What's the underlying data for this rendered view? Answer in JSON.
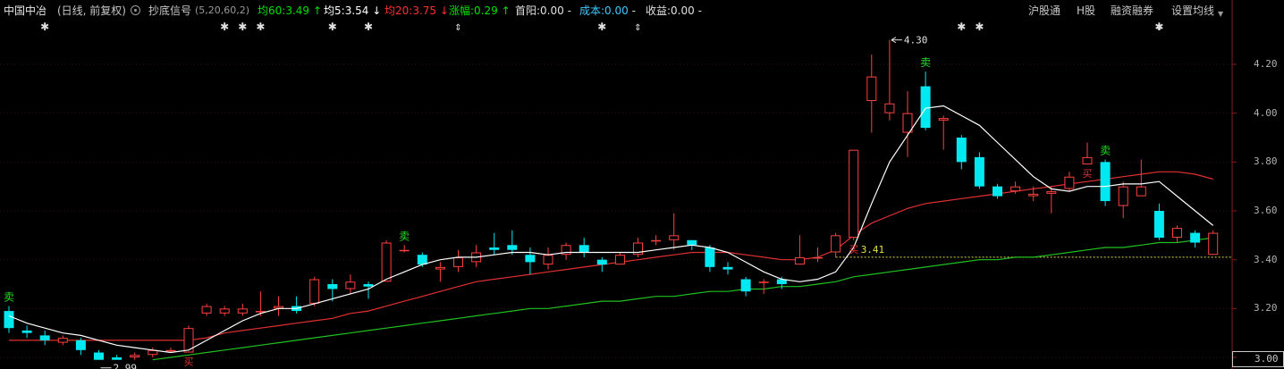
{
  "header": {
    "stock_name": "中国中冶",
    "mode": "(日线, 前复权)",
    "indicator_name": "抄底信号",
    "indicator_params": "(5,20,60,2)",
    "ma60": {
      "label": "均60:",
      "value": "3.49",
      "arrow": "↑",
      "color": "#00e000"
    },
    "ma5": {
      "label": "均5:",
      "value": "3.54",
      "arrow": "↓",
      "color": "#ffffff"
    },
    "ma20": {
      "label": "均20:",
      "value": "3.75",
      "arrow": "↓",
      "color": "#ff3030"
    },
    "change": {
      "label": "涨幅:",
      "value": "0.29",
      "arrow": "↑",
      "color": "#00e000"
    },
    "first_yang": {
      "label": "首阳:",
      "value": "0.00",
      "suffix": "-"
    },
    "cost": {
      "label": "成本:",
      "value": "0.00",
      "suffix": "-",
      "color": "#40c8ff"
    },
    "profit": {
      "label": "收益:",
      "value": "0.00",
      "suffix": "-"
    }
  },
  "menu": {
    "item1": "沪股通",
    "item2": "H股",
    "item3": "融资融券",
    "item4": "设置均线",
    "dropdown_icon": "triangle-down-icon"
  },
  "colors": {
    "up": "#ff4040",
    "down": "#00e8f0",
    "ma5": "#ffffff",
    "ma20": "#e03030",
    "ma60": "#20c020",
    "sell": "#20e020",
    "buy": "#e03030",
    "hline": "#e0e040"
  },
  "chart_data": {
    "type": "candlestick",
    "ylim": [
      3.0,
      4.3
    ],
    "yticks": [
      "4.20",
      "4.00",
      "3.80",
      "3.60",
      "3.40",
      "3.20",
      "3.00"
    ],
    "ytick_values": [
      4.2,
      4.0,
      3.8,
      3.6,
      3.4,
      3.2,
      3.0
    ],
    "candles": [
      [
        3.19,
        3.12,
        3.21,
        3.1
      ],
      [
        3.11,
        3.1,
        3.13,
        3.08
      ],
      [
        3.09,
        3.07,
        3.11,
        3.05
      ],
      [
        3.06,
        3.08,
        3.09,
        3.05
      ],
      [
        3.07,
        3.03,
        3.08,
        3.01
      ],
      [
        3.02,
        2.99,
        3.03,
        2.99
      ],
      [
        3.0,
        2.99,
        3.01,
        2.99
      ],
      [
        3.0,
        3.01,
        3.02,
        2.99
      ],
      [
        3.01,
        3.03,
        3.04,
        3.0
      ],
      [
        3.03,
        3.03,
        3.04,
        3.02
      ],
      [
        3.02,
        3.12,
        3.13,
        3.02
      ],
      [
        3.18,
        3.21,
        3.22,
        3.17
      ],
      [
        3.18,
        3.2,
        3.21,
        3.17
      ],
      [
        3.18,
        3.2,
        3.22,
        3.17
      ],
      [
        3.19,
        3.19,
        3.27,
        3.17
      ],
      [
        3.2,
        3.21,
        3.25,
        3.17
      ],
      [
        3.21,
        3.19,
        3.25,
        3.18
      ],
      [
        3.22,
        3.32,
        3.33,
        3.21
      ],
      [
        3.3,
        3.28,
        3.32,
        3.23
      ],
      [
        3.28,
        3.31,
        3.34,
        3.26
      ],
      [
        3.3,
        3.29,
        3.31,
        3.24
      ],
      [
        3.31,
        3.47,
        3.48,
        3.31
      ],
      [
        3.44,
        3.44,
        3.46,
        3.43
      ],
      [
        3.42,
        3.38,
        3.43,
        3.37
      ],
      [
        3.36,
        3.37,
        3.39,
        3.31
      ],
      [
        3.37,
        3.41,
        3.44,
        3.35
      ],
      [
        3.39,
        3.43,
        3.46,
        3.37
      ],
      [
        3.45,
        3.44,
        3.51,
        3.42
      ],
      [
        3.46,
        3.44,
        3.52,
        3.42
      ],
      [
        3.42,
        3.39,
        3.45,
        3.34
      ],
      [
        3.38,
        3.42,
        3.45,
        3.36
      ],
      [
        3.42,
        3.46,
        3.47,
        3.4
      ],
      [
        3.46,
        3.43,
        3.49,
        3.41
      ],
      [
        3.4,
        3.38,
        3.41,
        3.35
      ],
      [
        3.38,
        3.42,
        3.43,
        3.38
      ],
      [
        3.42,
        3.47,
        3.49,
        3.41
      ],
      [
        3.48,
        3.48,
        3.5,
        3.46
      ],
      [
        3.48,
        3.5,
        3.59,
        3.44
      ],
      [
        3.48,
        3.46,
        3.48,
        3.44
      ],
      [
        3.45,
        3.37,
        3.46,
        3.35
      ],
      [
        3.37,
        3.36,
        3.39,
        3.34
      ],
      [
        3.32,
        3.27,
        3.33,
        3.25
      ],
      [
        3.31,
        3.31,
        3.32,
        3.26
      ],
      [
        3.32,
        3.3,
        3.33,
        3.28
      ],
      [
        3.38,
        3.41,
        3.5,
        3.38
      ],
      [
        3.41,
        3.41,
        3.45,
        3.39
      ],
      [
        3.43,
        3.5,
        3.51,
        3.41
      ],
      [
        3.49,
        3.85,
        3.85,
        3.48
      ],
      [
        4.05,
        4.15,
        4.24,
        3.92
      ],
      [
        4.0,
        4.04,
        4.3,
        3.97
      ],
      [
        3.92,
        4.0,
        4.09,
        3.82
      ],
      [
        4.11,
        3.94,
        4.17,
        3.93
      ],
      [
        3.97,
        3.98,
        3.99,
        3.85
      ],
      [
        3.9,
        3.8,
        3.91,
        3.77
      ],
      [
        3.82,
        3.7,
        3.84,
        3.69
      ],
      [
        3.7,
        3.66,
        3.71,
        3.65
      ],
      [
        3.68,
        3.7,
        3.72,
        3.67
      ],
      [
        3.66,
        3.67,
        3.7,
        3.64
      ],
      [
        3.67,
        3.68,
        3.7,
        3.59
      ],
      [
        3.69,
        3.74,
        3.76,
        3.68
      ],
      [
        3.79,
        3.82,
        3.88,
        3.79
      ],
      [
        3.8,
        3.64,
        3.81,
        3.62
      ],
      [
        3.62,
        3.7,
        3.72,
        3.57
      ],
      [
        3.66,
        3.7,
        3.81,
        3.66
      ],
      [
        3.6,
        3.49,
        3.63,
        3.48
      ],
      [
        3.49,
        3.53,
        3.54,
        3.47
      ],
      [
        3.51,
        3.47,
        3.52,
        3.45
      ],
      [
        3.42,
        3.51,
        3.52,
        3.42
      ]
    ],
    "ma5": [
      3.17,
      3.14,
      3.12,
      3.1,
      3.09,
      3.07,
      3.05,
      3.04,
      3.03,
      3.02,
      3.03,
      3.07,
      3.11,
      3.15,
      3.18,
      3.2,
      3.2,
      3.22,
      3.24,
      3.26,
      3.28,
      3.32,
      3.35,
      3.38,
      3.4,
      3.41,
      3.41,
      3.42,
      3.43,
      3.43,
      3.42,
      3.43,
      3.43,
      3.43,
      3.43,
      3.43,
      3.44,
      3.45,
      3.46,
      3.45,
      3.43,
      3.39,
      3.35,
      3.32,
      3.31,
      3.32,
      3.35,
      3.45,
      3.63,
      3.8,
      3.91,
      4.02,
      4.03,
      3.99,
      3.95,
      3.88,
      3.81,
      3.74,
      3.69,
      3.68,
      3.7,
      3.7,
      3.71,
      3.71,
      3.72,
      3.66,
      3.6,
      3.54
    ],
    "ma20": [
      3.07,
      3.07,
      3.07,
      3.07,
      3.07,
      3.07,
      3.07,
      3.07,
      3.07,
      3.07,
      3.07,
      3.08,
      3.1,
      3.11,
      3.12,
      3.13,
      3.14,
      3.15,
      3.16,
      3.18,
      3.19,
      3.21,
      3.23,
      3.25,
      3.27,
      3.29,
      3.31,
      3.32,
      3.33,
      3.34,
      3.35,
      3.36,
      3.37,
      3.38,
      3.39,
      3.4,
      3.41,
      3.42,
      3.43,
      3.43,
      3.43,
      3.42,
      3.41,
      3.4,
      3.4,
      3.41,
      3.44,
      3.5,
      3.55,
      3.58,
      3.61,
      3.63,
      3.64,
      3.65,
      3.66,
      3.67,
      3.68,
      3.69,
      3.7,
      3.71,
      3.72,
      3.73,
      3.74,
      3.75,
      3.76,
      3.76,
      3.75,
      3.73
    ],
    "ma60": [
      null,
      null,
      null,
      null,
      null,
      null,
      null,
      null,
      2.99,
      3.0,
      3.01,
      3.02,
      3.03,
      3.04,
      3.05,
      3.06,
      3.07,
      3.08,
      3.09,
      3.1,
      3.11,
      3.12,
      3.13,
      3.14,
      3.15,
      3.16,
      3.17,
      3.18,
      3.19,
      3.2,
      3.2,
      3.21,
      3.22,
      3.23,
      3.23,
      3.24,
      3.25,
      3.25,
      3.26,
      3.27,
      3.27,
      3.28,
      3.28,
      3.29,
      3.29,
      3.3,
      3.31,
      3.33,
      3.34,
      3.35,
      3.36,
      3.37,
      3.38,
      3.39,
      3.4,
      3.4,
      3.41,
      3.41,
      3.42,
      3.43,
      3.44,
      3.45,
      3.45,
      3.46,
      3.47,
      3.47,
      3.48,
      3.49
    ],
    "star_markers": [
      2,
      12,
      13,
      14,
      18,
      20,
      33,
      53,
      54,
      64
    ],
    "diamond_markers": [
      25,
      35,
      64
    ],
    "sell_signals": [
      0,
      22,
      51,
      61
    ],
    "buy_signals": [
      10,
      47,
      60
    ],
    "low_annotation": {
      "index": 5,
      "text": "2.99"
    },
    "high_annotation": {
      "index": 49,
      "text": "4.30"
    },
    "price_line": {
      "value": 3.41,
      "text": "3.41"
    },
    "sell_label": "卖",
    "buy_label": "买"
  }
}
